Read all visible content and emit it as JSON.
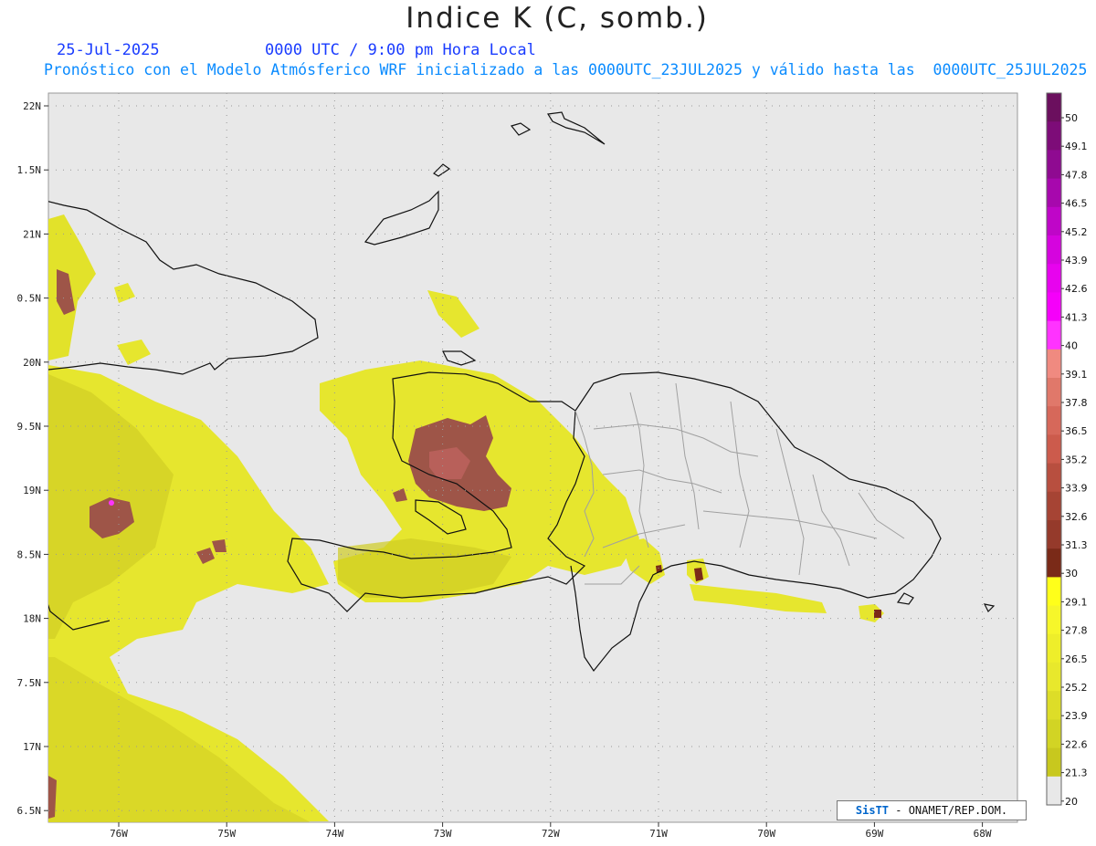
{
  "title": "Indice K (C, somb.)",
  "date": "25-Jul-2025",
  "time": "0000 UTC / 9:00 pm Hora Local",
  "forecast_line": "Pronóstico con el Modelo Atmósferico WRF inicializado a las 0000UTC_23JUL2025 y válido hasta las  0000UTC_25JUL2025",
  "credit": {
    "brand": "SisTT",
    "org": " - ONAMET/REP.DOM."
  },
  "map": {
    "lon_labels": [
      "76W",
      "75W",
      "74W",
      "73W",
      "72W",
      "71W",
      "70W",
      "69W",
      "68W"
    ],
    "lat_labels": [
      "22N",
      "1.5N",
      "21N",
      "0.5N",
      "20N",
      "9.5N",
      "19N",
      "8.5N",
      "18N",
      "7.5N",
      "17N",
      "6.5N"
    ],
    "background": "#e8e8e8",
    "coast_color": "#111111",
    "border_color": "#a0a0a0",
    "grid_style": "dotted"
  },
  "colorbar": {
    "labels": [
      "50",
      "49.1",
      "47.8",
      "46.5",
      "45.2",
      "43.9",
      "42.6",
      "41.3",
      "40",
      "39.1",
      "37.8",
      "36.5",
      "35.2",
      "33.9",
      "32.6",
      "31.3",
      "30",
      "29.1",
      "27.8",
      "26.5",
      "25.2",
      "23.9",
      "22.6",
      "21.3",
      "20"
    ],
    "colors": [
      "#6b0f5e",
      "#7d0c78",
      "#8f0a91",
      "#a708ad",
      "#bf06c8",
      "#d504de",
      "#e703ee",
      "#f500fa",
      "#ff33ff",
      "#f08a80",
      "#e0786a",
      "#d6685a",
      "#cc5b4c",
      "#b84f3f",
      "#a64434",
      "#953a2b",
      "#7a2a18",
      "#ffff1a",
      "#f6f62a",
      "#eeee2a",
      "#e8e82c",
      "#dddd28",
      "#d2d424",
      "#c8c81e",
      "#e8e8e8"
    ]
  },
  "regions": {
    "haiti_core": "#9e5548",
    "hot_spot": "#b8534a",
    "yellow": "#e6e62e",
    "yellow_light": "#f2f239",
    "olive": "#c9c620"
  }
}
